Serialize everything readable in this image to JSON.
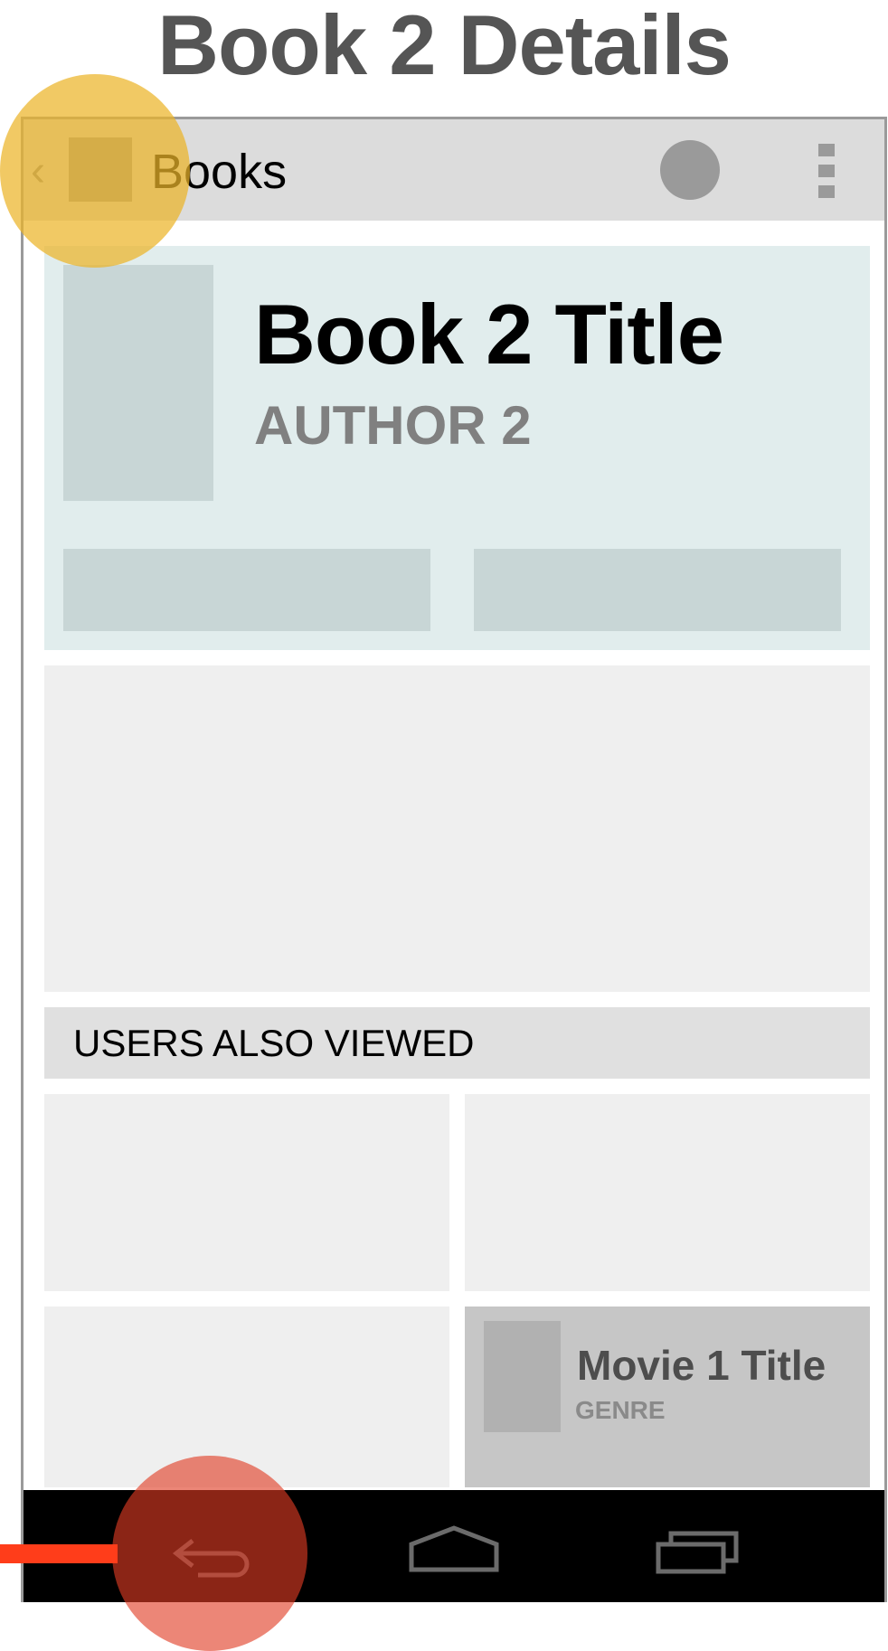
{
  "page_title": "Book 2 Details",
  "action_bar": {
    "title": "Books",
    "up_icon": "chevron-left-icon",
    "app_icon": "app-icon",
    "action_icon": "circle-action-icon",
    "overflow_icon": "overflow-menu-icon"
  },
  "book": {
    "title": "Book 2 Title",
    "author": "AUTHOR 2"
  },
  "related": {
    "header": "USERS ALSO VIEWED",
    "items": [
      {
        "title": "Movie 1 Title",
        "genre": "GENRE"
      }
    ]
  },
  "nav_bar": {
    "icons": [
      "back-icon",
      "home-icon",
      "recents-icon"
    ]
  },
  "colors": {
    "highlight_up": "#ecb428",
    "highlight_back": "#e13c23",
    "pointer": "#ff3d1a",
    "header_panel": "#e1eded"
  }
}
